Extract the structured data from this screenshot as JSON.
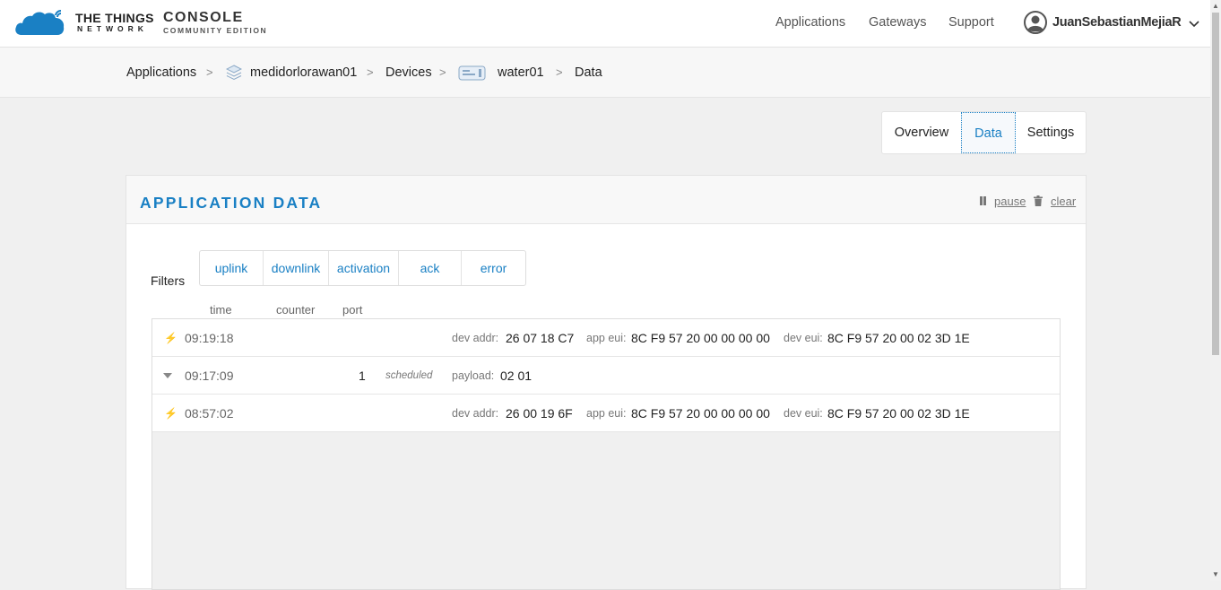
{
  "brand": {
    "logo_line1": "THE THINGS",
    "logo_line2": "NETWORK",
    "console_line1": "CONSOLE",
    "console_line2": "COMMUNITY EDITION",
    "accent_color": "#1a80c4"
  },
  "nav": {
    "applications": "Applications",
    "gateways": "Gateways",
    "support": "Support",
    "user": "JuanSebastianMejiaR"
  },
  "breadcrumb": {
    "applications": "Applications",
    "app_name": "medidorlorawan01",
    "devices": "Devices",
    "device_name": "water01",
    "current": "Data",
    "separator": ">"
  },
  "tabs": {
    "overview": "Overview",
    "data": "Data",
    "settings": "Settings",
    "active": "Data"
  },
  "panel": {
    "title": "APPLICATION DATA",
    "pause": "pause",
    "clear": "clear"
  },
  "filters": {
    "label": "Filters",
    "items": [
      "uplink",
      "downlink",
      "activation",
      "ack",
      "error"
    ]
  },
  "columns": {
    "time": "time",
    "counter": "counter",
    "port": "port"
  },
  "rows": [
    {
      "icon": "lightning-icon",
      "time": "09:19:18",
      "dev_addr_label": "dev addr:",
      "dev_addr": "26 07 18 C7",
      "app_eui_label": "app eui:",
      "app_eui": "8C F9 57 20 00 00 00 00",
      "dev_eui_label": "dev eui:",
      "dev_eui": "8C F9 57 20 00 02 3D 1E"
    },
    {
      "icon": "caret-down-icon",
      "time": "09:17:09",
      "port": "1",
      "status": "scheduled",
      "payload_label": "payload:",
      "payload": "02 01"
    },
    {
      "icon": "lightning-icon",
      "time": "08:57:02",
      "dev_addr_label": "dev addr:",
      "dev_addr": "26 00 19 6F",
      "app_eui_label": "app eui:",
      "app_eui": "8C F9 57 20 00 00 00 00",
      "dev_eui_label": "dev eui:",
      "dev_eui": "8C F9 57 20 00 02 3D 1E"
    }
  ]
}
